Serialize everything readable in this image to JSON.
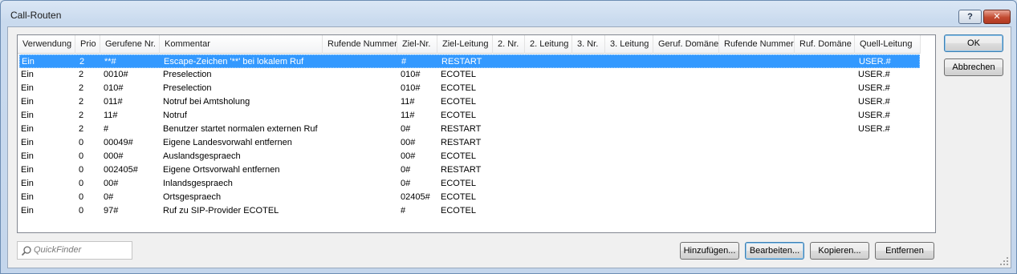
{
  "window": {
    "title": "Call-Routen",
    "help_label": "?",
    "close_label": "✕"
  },
  "table": {
    "columns": [
      "Verwendung",
      "Prio",
      "Gerufene Nr.",
      "Kommentar",
      "Rufende Nummer",
      "Ziel-Nr.",
      "Ziel-Leitung",
      "2. Nr.",
      "2. Leitung",
      "3. Nr.",
      "3. Leitung",
      "Geruf. Domäne",
      "Rufende Nummer",
      "Ruf. Domäne",
      "Quell-Leitung"
    ],
    "selected_row": 0,
    "rows": [
      [
        "Ein",
        "2",
        "**#",
        "Escape-Zeichen '**' bei lokalem Ruf",
        "",
        "#",
        "RESTART",
        "",
        "",
        "",
        "",
        "",
        "",
        "",
        "USER.#"
      ],
      [
        "Ein",
        "2",
        "0010#",
        "Preselection",
        "",
        "010#",
        "ECOTEL",
        "",
        "",
        "",
        "",
        "",
        "",
        "",
        "USER.#"
      ],
      [
        "Ein",
        "2",
        "010#",
        "Preselection",
        "",
        "010#",
        "ECOTEL",
        "",
        "",
        "",
        "",
        "",
        "",
        "",
        "USER.#"
      ],
      [
        "Ein",
        "2",
        "011#",
        "Notruf bei Amtsholung",
        "",
        "11#",
        "ECOTEL",
        "",
        "",
        "",
        "",
        "",
        "",
        "",
        "USER.#"
      ],
      [
        "Ein",
        "2",
        "11#",
        "Notruf",
        "",
        "11#",
        "ECOTEL",
        "",
        "",
        "",
        "",
        "",
        "",
        "",
        "USER.#"
      ],
      [
        "Ein",
        "2",
        "#",
        "Benutzer startet normalen externen Ruf",
        "",
        "0#",
        "RESTART",
        "",
        "",
        "",
        "",
        "",
        "",
        "",
        "USER.#"
      ],
      [
        "Ein",
        "0",
        "00049#",
        "Eigene Landesvorwahl entfernen",
        "",
        "00#",
        "RESTART",
        "",
        "",
        "",
        "",
        "",
        "",
        "",
        ""
      ],
      [
        "Ein",
        "0",
        "000#",
        "Auslandsgespraech",
        "",
        "00#",
        "ECOTEL",
        "",
        "",
        "",
        "",
        "",
        "",
        "",
        ""
      ],
      [
        "Ein",
        "0",
        "002405#",
        "Eigene Ortsvorwahl entfernen",
        "",
        "0#",
        "RESTART",
        "",
        "",
        "",
        "",
        "",
        "",
        "",
        ""
      ],
      [
        "Ein",
        "0",
        "00#",
        "Inlandsgespraech",
        "",
        "0#",
        "ECOTEL",
        "",
        "",
        "",
        "",
        "",
        "",
        "",
        ""
      ],
      [
        "Ein",
        "0",
        "0#",
        "Ortsgespraech",
        "",
        "02405#",
        "ECOTEL",
        "",
        "",
        "",
        "",
        "",
        "",
        "",
        ""
      ],
      [
        "Ein",
        "0",
        "97#",
        "Ruf zu SIP-Provider ECOTEL",
        "",
        "#",
        "ECOTEL",
        "",
        "",
        "",
        "",
        "",
        "",
        "",
        ""
      ]
    ]
  },
  "buttons": {
    "ok": "OK",
    "cancel": "Abbrechen",
    "add": "Hinzufügen...",
    "edit": "Bearbeiten...",
    "copy": "Kopieren...",
    "remove": "Entfernen"
  },
  "quickfinder": {
    "placeholder": "QuickFinder",
    "icon": "search-icon"
  },
  "colors": {
    "selection": "#3399ff",
    "title_bg": "#c9daee",
    "close_red": "#c24a31"
  }
}
